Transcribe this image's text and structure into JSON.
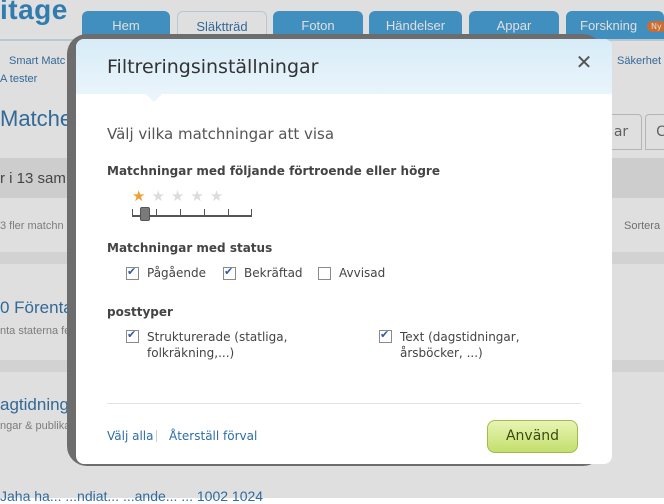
{
  "background": {
    "logo": "itage",
    "nav_tabs": [
      "Hem",
      "Släktträd",
      "Foton",
      "Händelser",
      "Appar",
      "Forskning"
    ],
    "new_badge": "Ny",
    "links": [
      "Smart Matc",
      "A tester",
      "Säkerhet"
    ],
    "heading": "Matches",
    "count_bar": "r i 13 sam",
    "more_matches": "3 fler matchn",
    "sort_label": "Sortera",
    "tab_right_1": "ar",
    "tab_right_2": "C",
    "item_1": "0 Förenta",
    "item_1_sub": "nta staterna fe",
    "item_2": "agtidnings",
    "item_2_sub": "ngar & publika",
    "item_3": "Jaha ha... ...ndiat... ...ande... ... 1002 1024"
  },
  "modal": {
    "title": "Filtreringsinställningar",
    "close_glyph": "✕",
    "subtitle": "Välj vilka matchningar att visa",
    "confidence_label": "Matchningar med följande förtroende eller högre",
    "stars_total": 5,
    "stars_selected": 1,
    "status_label": "Matchningar med status",
    "statuses": [
      {
        "label": "Pågående",
        "checked": true
      },
      {
        "label": "Bekräftad",
        "checked": true
      },
      {
        "label": "Avvisad",
        "checked": false
      }
    ],
    "posttypes_label": "posttyper",
    "posttypes": [
      {
        "label": "Strukturerade (statliga, folkräkning,...)",
        "checked": true
      },
      {
        "label": "Text (dagstidningar, årsböcker, ...)",
        "checked": true
      }
    ],
    "select_all": "Välj alla",
    "reset_default": "Återställ förval",
    "apply": "Använd"
  },
  "colors": {
    "accent": "#2c6fa8",
    "nav_tab": "#3f9ed8",
    "apply_button": "#c4df6c",
    "star_on": "#f0a033"
  }
}
